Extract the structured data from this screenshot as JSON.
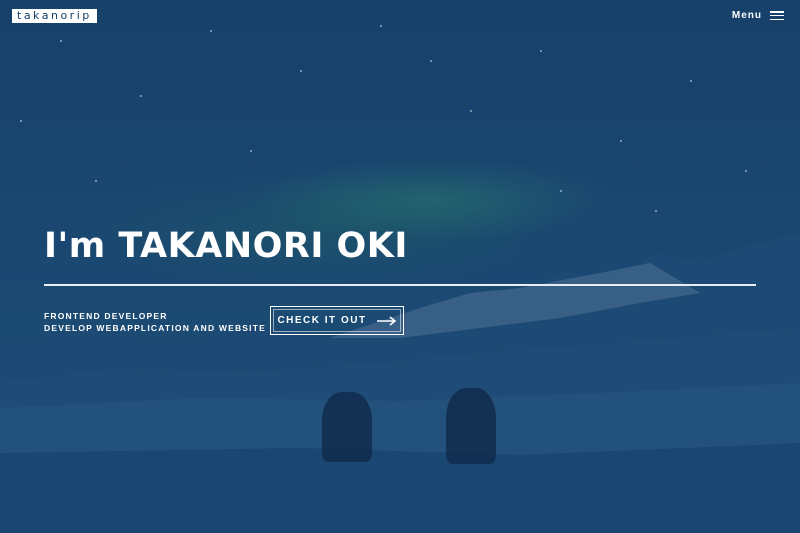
{
  "header": {
    "logo_text": "takanorip",
    "menu_label": "Menu",
    "menu_icon": "hamburger-icon"
  },
  "hero": {
    "headline": "I'm TAKANORI OKI",
    "tagline_line1": "FRONTEND DEVELOPER",
    "tagline_line2": "DEVELOP WEBAPPLICATION AND WEBSITE",
    "cta_label": "CHECK IT OUT",
    "cta_icon": "arrow-right-icon"
  },
  "colors": {
    "overlay": "#173d66",
    "text": "#ffffff"
  }
}
